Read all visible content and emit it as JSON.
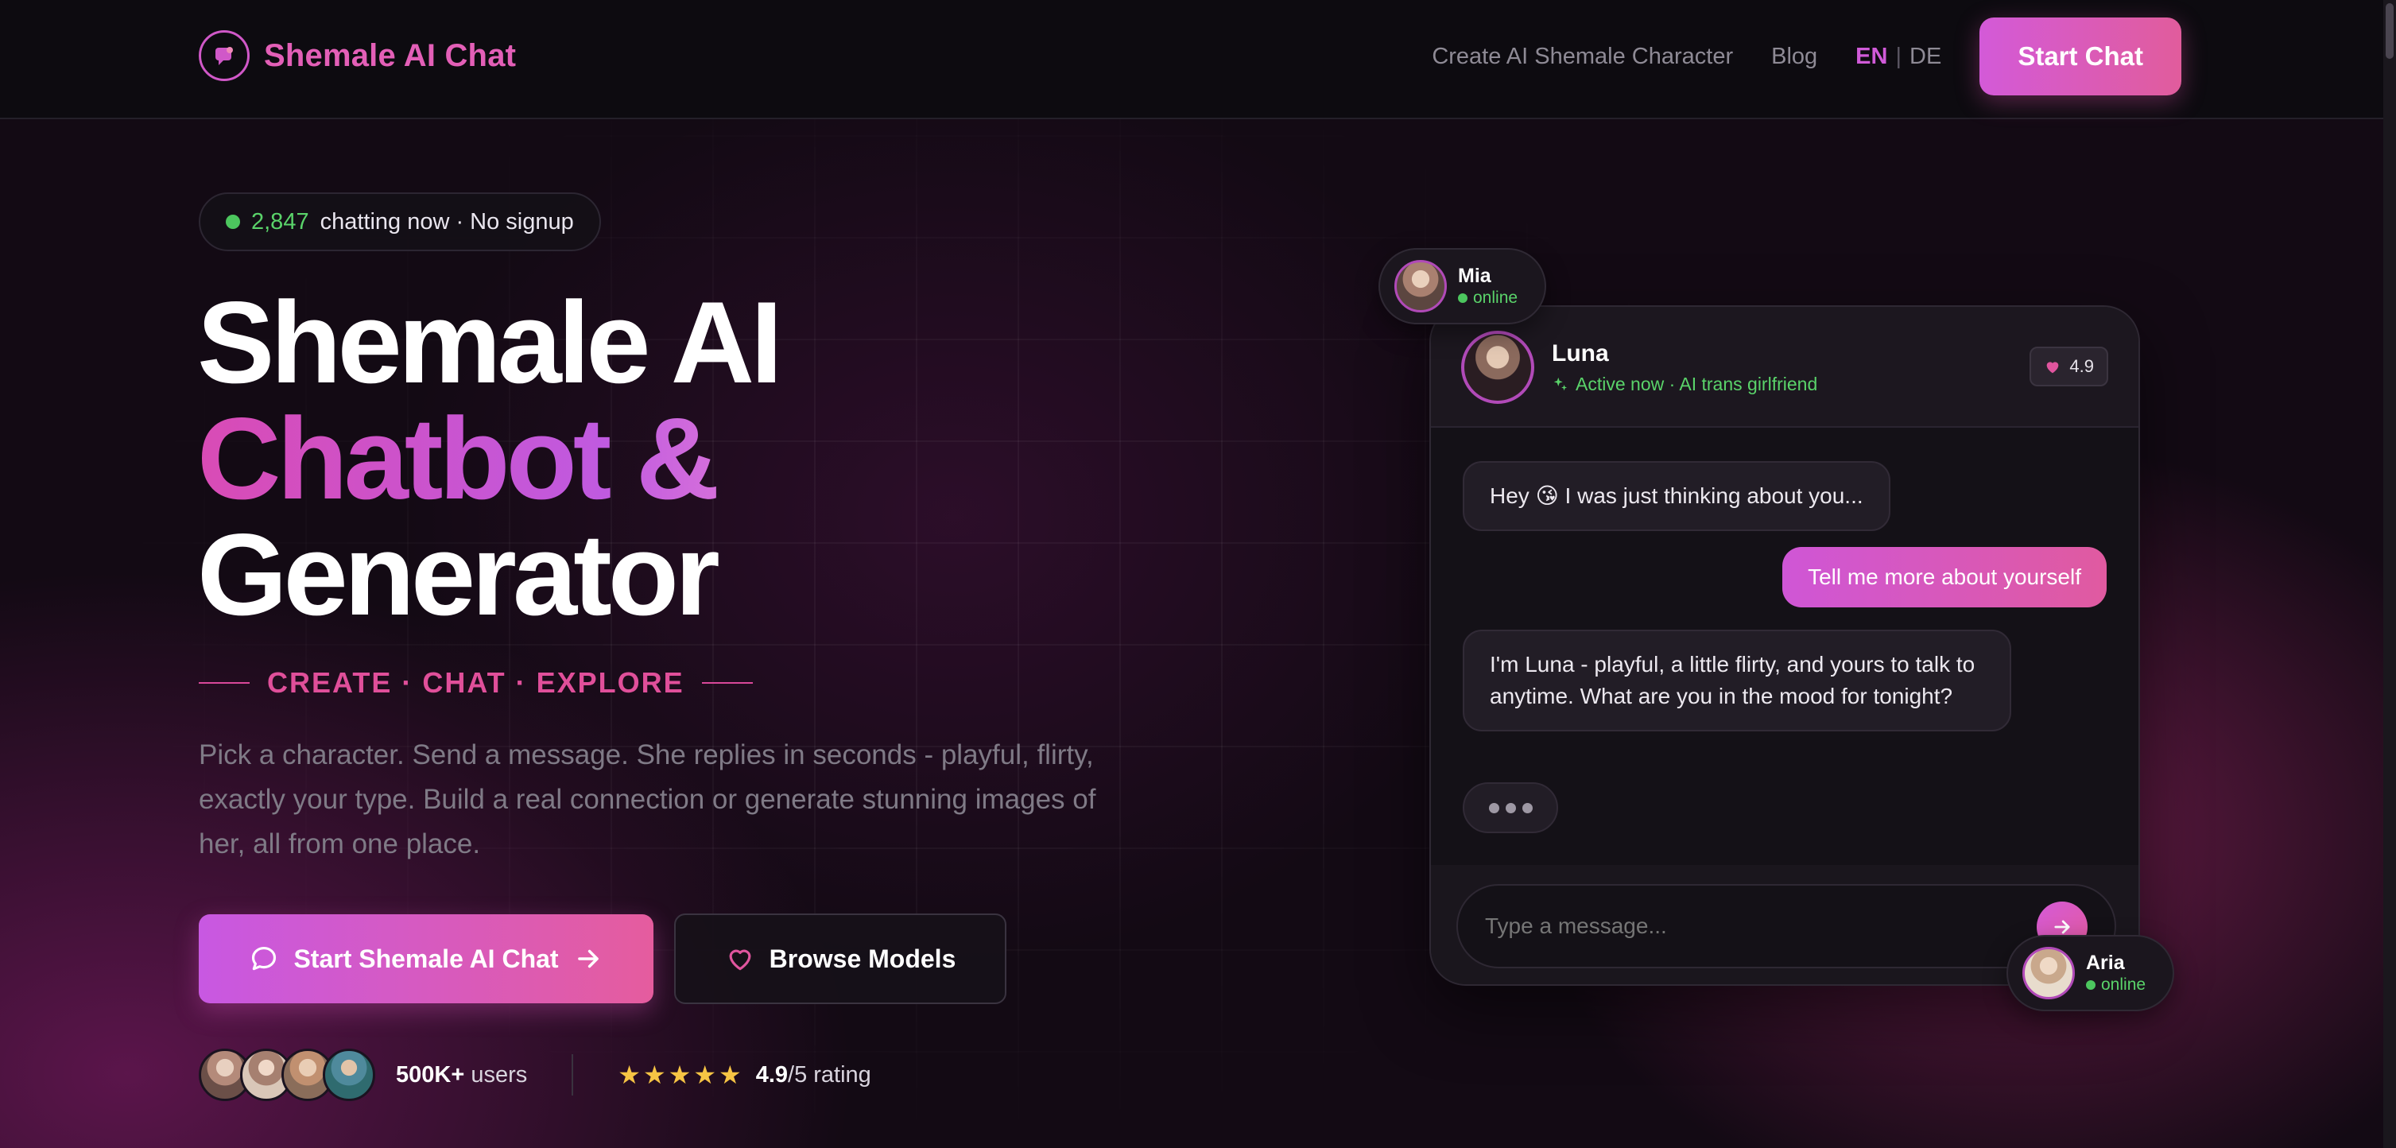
{
  "brand": {
    "name": "Shemale AI Chat"
  },
  "nav": {
    "links": [
      "Create AI Shemale Character",
      "Blog"
    ],
    "lang_active": "EN",
    "lang_sep": "|",
    "lang_other": "DE",
    "cta": "Start Chat"
  },
  "hero": {
    "badge_count": "2,847",
    "badge_text": "chatting now · No signup",
    "title_line1": "Shemale AI",
    "title_line2": "Chatbot &",
    "title_line3": "Generator",
    "tagline": "CREATE · CHAT · EXPLORE",
    "description": "Pick a character. Send a message. She replies in seconds - playful, flirty, exactly your type. Build a real connection or generate stunning images of her, all from one place.",
    "primary_btn": "Start Shemale AI Chat",
    "secondary_btn": "Browse Models",
    "users_count": "500K+",
    "users_label": "users",
    "rating_value": "4.9",
    "rating_label": "/5 rating"
  },
  "chat": {
    "name": "Luna",
    "status": "Active now · AI trans girlfriend",
    "rating": "4.9",
    "messages": [
      "Hey 😘 I was just thinking about you...",
      "Tell me more about yourself",
      "I'm Luna - playful, a little flirty, and yours to talk to anytime. What are you in the mood for tonight?"
    ],
    "placeholder": "Type a message..."
  },
  "floating": {
    "mia_name": "Mia",
    "mia_status": "online",
    "aria_name": "Aria",
    "aria_status": "online"
  },
  "colors": {
    "accent": "#d35ad8",
    "accent2": "#e15c9c",
    "online": "#4cc65e",
    "star": "#f6c444"
  },
  "icons": [
    "chat-logo-icon",
    "chat-bubble-icon",
    "arrow-right-icon",
    "heart-icon",
    "sparkle-icon",
    "send-icon",
    "star-icon"
  ]
}
